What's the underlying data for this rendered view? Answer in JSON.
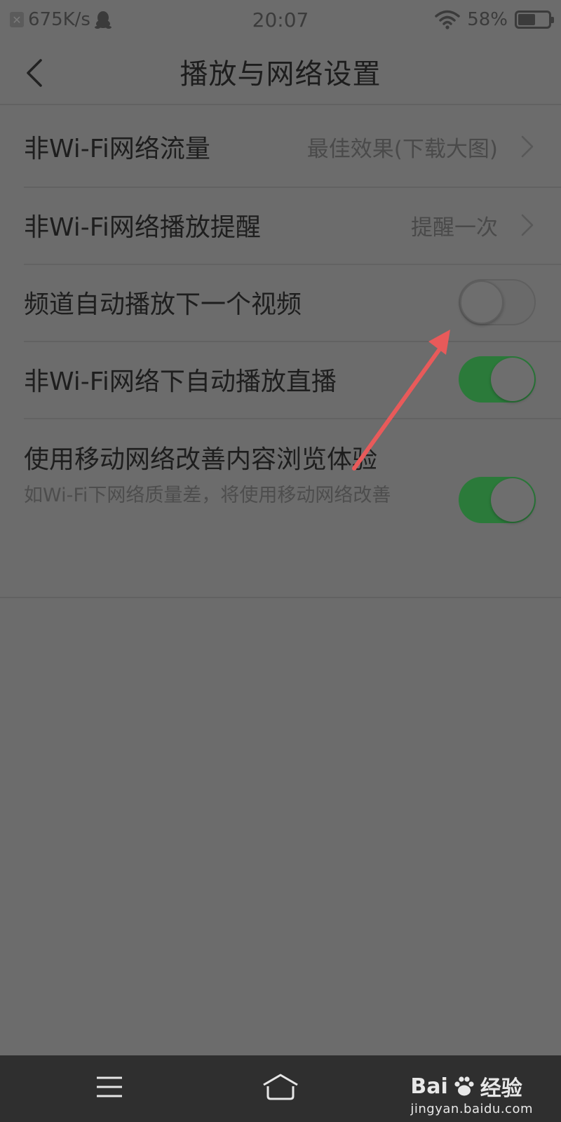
{
  "status_bar": {
    "speed": "675K/s",
    "time": "20:07",
    "battery_percent": "58%",
    "battery_level": 0.58,
    "icons": [
      "notification-x-icon",
      "qq-penguin-icon",
      "wifi-icon",
      "battery-icon"
    ]
  },
  "nav": {
    "title": "播放与网络设置",
    "back_icon": "chevron-left-icon"
  },
  "settings": {
    "traffic": {
      "label": "非Wi-Fi网络流量",
      "value": "最佳效果(下载大图)"
    },
    "reminder": {
      "label": "非Wi-Fi网络播放提醒",
      "value": "提醒一次"
    },
    "autoplay_next": {
      "label": "频道自动播放下一个视频",
      "enabled": false
    },
    "autoplay_live": {
      "label": "非Wi-Fi网络下自动播放直播",
      "enabled": true
    },
    "mobile_assist": {
      "label": "使用移动网络改善内容浏览体验",
      "description": "如Wi-Fi下网络质量差，将使用移动网络改善",
      "enabled": true
    }
  },
  "colors": {
    "toggle_on": "#2b7a3a",
    "annotation_arrow": "#e85a5a",
    "page_background": "#6c6c6c",
    "system_nav": "#2f2f2f"
  },
  "system_nav": {
    "icons": [
      "menu-icon",
      "home-icon"
    ]
  },
  "watermark": {
    "brand_left": "Bai",
    "brand_right": "经验",
    "url": "jingyan.baidu.com"
  }
}
